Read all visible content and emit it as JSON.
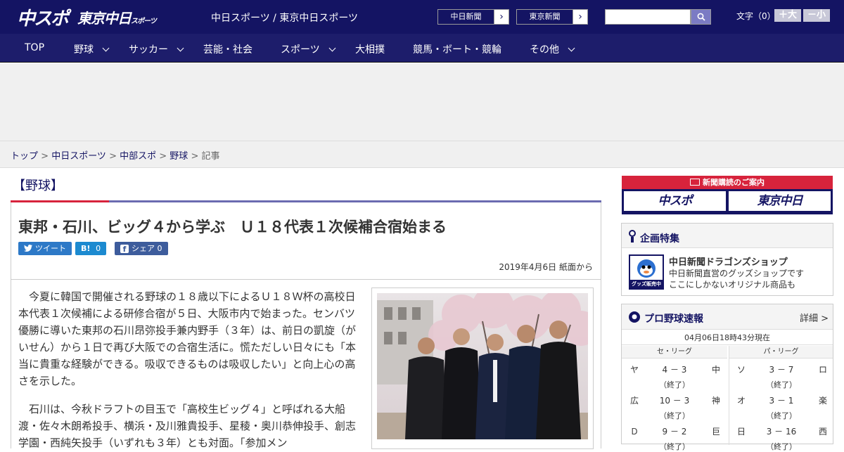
{
  "header": {
    "logo_main": "中スポ",
    "logo_tokyo": "東京中日",
    "logo_tokyo_small": "スポーツ",
    "site_name": "中日スポーツ / 東京中日スポーツ",
    "ext_links": [
      {
        "label": "中日新聞"
      },
      {
        "label": "東京新聞"
      }
    ],
    "search_placeholder": "",
    "font_label": "文字（0）",
    "font_larger": "＋大",
    "font_smaller": "－小"
  },
  "nav": [
    {
      "label": "TOP",
      "dropdown": false
    },
    {
      "label": "野球",
      "dropdown": true
    },
    {
      "label": "サッカー",
      "dropdown": true
    },
    {
      "label": "芸能・社会",
      "dropdown": false
    },
    {
      "label": "スポーツ",
      "dropdown": true
    },
    {
      "label": "大相撲",
      "dropdown": false
    },
    {
      "label": "競馬・ボート・競輪",
      "dropdown": false
    },
    {
      "label": "その他",
      "dropdown": true
    }
  ],
  "breadcrumb": {
    "items": [
      "トップ",
      "中日スポーツ",
      "中部スポ",
      "野球"
    ],
    "current": "記事",
    "sep": " > "
  },
  "article": {
    "category": "【野球】",
    "headline": "東邦・石川、ビッグ４から学ぶ　Ｕ１８代表１次候補合宿始まる",
    "share": {
      "tweet": "ツイート",
      "hatena_count": "0",
      "fb_label": "シェア",
      "fb_count": "0"
    },
    "date": "2019年4月6日 紙面から",
    "paragraphs": [
      "今夏に韓国で開催される野球の１８歳以下によるＵ１８Ｗ杯の高校日本代表１次候補による研修合宿が５日、大阪市内で始まった。センバツ優勝に導いた東邦の石川昂弥投手兼内野手（３年）は、前日の凱旋（がいせん）から１日で再び大阪での合宿生活に。慌ただしい日々にも「本当に貴重な経験ができる。吸収できるものは吸収したい」と向上心の高さを示した。",
      "石川は、今秋ドラフトの目玉で「高校生ビッグ４」と呼ばれる大船渡・佐々木朗希投手、横浜・及川雅貴投手、星稜・奥川恭伸投手、創志学園・西純矢投手（いずれも３年）とも対面。「参加メン"
    ]
  },
  "sidebar": {
    "subscribe": {
      "title": "新聞購読のご案内",
      "logo1": "中スポ",
      "logo2": "東京中日"
    },
    "feature": {
      "title": "企画特集",
      "thumb_label": "グッズ販売中",
      "name": "中日新聞ドラゴンズショップ",
      "desc1": "中日新聞直営のグッズショップです",
      "desc2": "ここにしかないオリジナル商品も"
    },
    "scores": {
      "title": "プロ野球速報",
      "more": "詳細 >",
      "time": "04月06日18時43分現在",
      "central_label": "セ・リーグ",
      "pacific_label": "パ・リーグ",
      "central": [
        {
          "home": "ヤ",
          "score": "4 － 3",
          "away": "中",
          "status": "（終了）"
        },
        {
          "home": "広",
          "score": "10 － 3",
          "away": "神",
          "status": "（終了）"
        },
        {
          "home": "Ｄ",
          "score": "9 － 2",
          "away": "巨",
          "status": "（終了）"
        }
      ],
      "pacific": [
        {
          "home": "ソ",
          "score": "3 － 7",
          "away": "ロ",
          "status": "（終了）"
        },
        {
          "home": "オ",
          "score": "3 － 1",
          "away": "楽",
          "status": "（終了）"
        },
        {
          "home": "日",
          "score": "3 － 16",
          "away": "西",
          "status": "（終了）"
        }
      ]
    }
  },
  "colors": {
    "header_bg": "#141463",
    "nav_bg": "#1d1d6b",
    "accent_red": "#d7233c",
    "accent_purple": "#6b6bb0"
  }
}
